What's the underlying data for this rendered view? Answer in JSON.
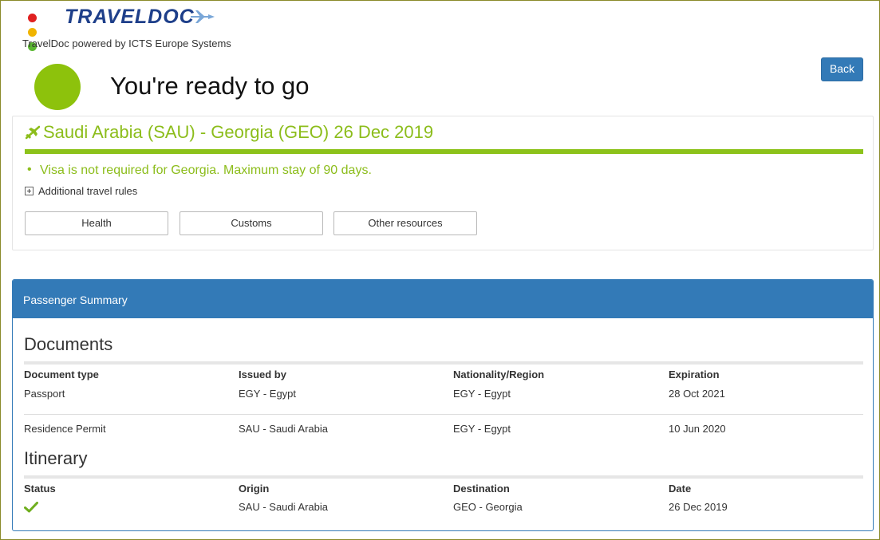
{
  "brand": {
    "logo_text": "TRAVELDOC",
    "logo_dot_colors": [
      "#e02020",
      "#f0b400",
      "#5bb832"
    ],
    "powered_by": "TravelDoc powered by ICTS Europe Systems"
  },
  "header": {
    "back_label": "Back",
    "status_title": "You're ready to go",
    "status_color": "#8dc20c"
  },
  "trip": {
    "route": "Saudi Arabia (SAU) - Georgia (GEO) 26 Dec 2019",
    "visa_note": "Visa is not required for Georgia. Maximum stay of 90 days.",
    "additional_rules_label": "Additional travel rules",
    "resource_buttons": [
      "Health",
      "Customs",
      "Other resources"
    ],
    "accent_color": "#8cbd1b"
  },
  "summary": {
    "title": "Passenger Summary",
    "documents": {
      "title": "Documents",
      "columns": [
        "Document type",
        "Issued by",
        "Nationality/Region",
        "Expiration"
      ],
      "rows": [
        [
          "Passport",
          "EGY - Egypt",
          "EGY - Egypt",
          "28 Oct 2021"
        ],
        [
          "Residence Permit",
          "SAU - Saudi Arabia",
          "EGY - Egypt",
          "10 Jun 2020"
        ]
      ]
    },
    "itinerary": {
      "title": "Itinerary",
      "columns": [
        "Status",
        "Origin",
        "Destination",
        "Date"
      ],
      "rows": [
        [
          "check-icon",
          "SAU - Saudi Arabia",
          "GEO - Georgia",
          "26 Dec 2019"
        ]
      ]
    }
  }
}
